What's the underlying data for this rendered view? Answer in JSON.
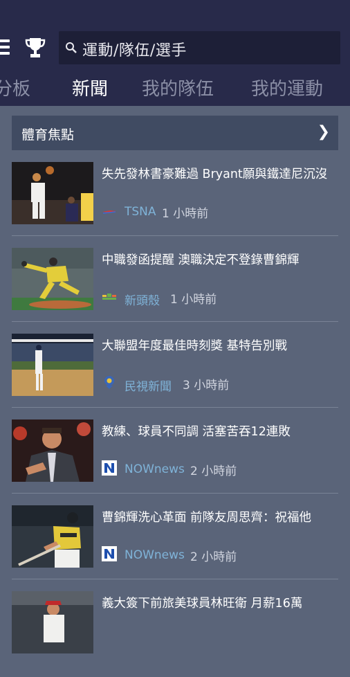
{
  "header": {
    "search_text": "運動/隊伍/選手",
    "tabs": [
      {
        "label": "分板"
      },
      {
        "label": "新聞"
      },
      {
        "label": "我的隊伍"
      },
      {
        "label": "我的運動"
      }
    ],
    "active_tab": 1
  },
  "section": {
    "title": "體育焦點",
    "chevron": "❯"
  },
  "news": [
    {
      "headline": "失先發林書豪難過 Bryant願與鐵達尼沉沒",
      "source": "TSNA",
      "time": "1 小時前",
      "thumb": "basketball-photo"
    },
    {
      "headline": "中職發函提醒 澳職決定不登錄曹錦輝",
      "source": "新頭殼",
      "time": "1 小時前",
      "thumb": "baseball-pitcher-photo"
    },
    {
      "headline": "大聯盟年度最佳時刻獎 基特告別戰",
      "source": "民視新聞",
      "time": "3 小時前",
      "thumb": "stadium-photo"
    },
    {
      "headline": "教練、球員不同調 活塞苦吞12連敗",
      "source": "NOWnews",
      "time": "2 小時前",
      "thumb": "coach-photo"
    },
    {
      "headline": "曹錦輝洗心革面 前隊友周思齊：祝福他",
      "source": "NOWnews",
      "time": "2 小時前",
      "thumb": "batter-photo"
    },
    {
      "headline": "義大簽下前旅美球員林旺衛 月薪16萬",
      "source": "",
      "time": "",
      "thumb": "player-photo"
    }
  ]
}
